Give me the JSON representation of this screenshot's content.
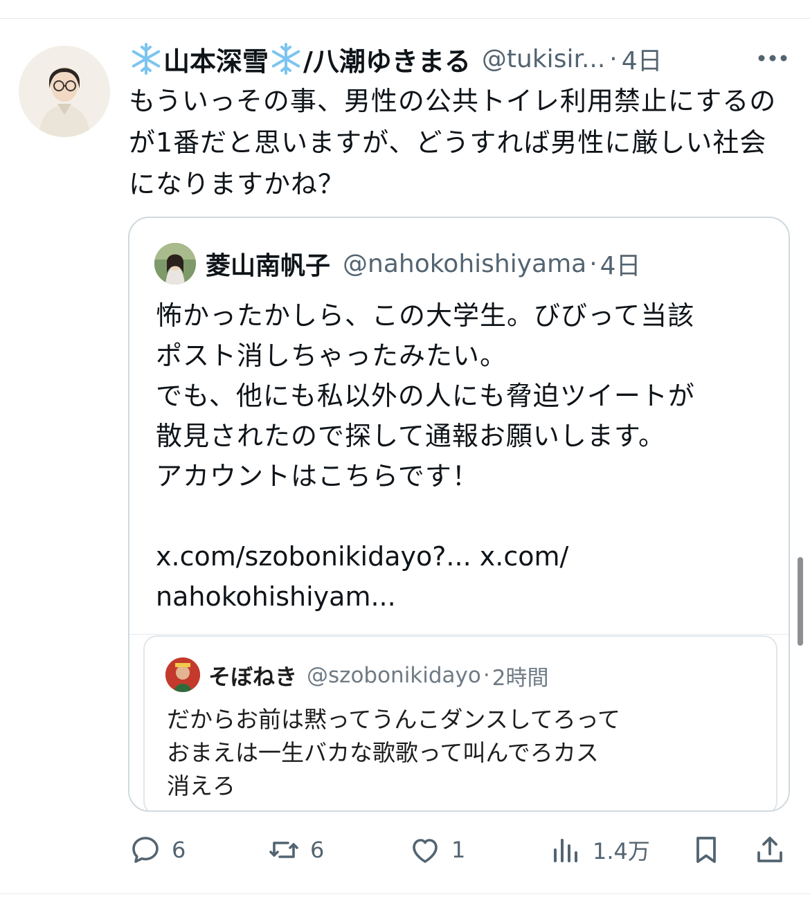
{
  "tweet": {
    "author": {
      "name_before": "山本深雪",
      "name_after": "/八潮ゆきまる",
      "handle": "@tukisir...",
      "dot": "·",
      "time": "4日"
    },
    "text": "もういっその事、男性の公共トイレ利用禁止にするのが1番だと思いますが、どうすれば男性に厳しい社会になりますかね？"
  },
  "quote": {
    "author": {
      "name": "菱山南帆子",
      "handle": "@nahokohishiyama",
      "dot": "·",
      "time": "4日"
    },
    "lines": [
      "怖かったかしら、この大学生。びびって当該",
      "ポスト消しちゃったみたい。",
      "でも、他にも私以外の人にも脅迫ツイートが",
      "散見されたので探して通報お願いします。",
      "アカウントはこちらです！"
    ],
    "links": {
      "link1": "x.com/szobonikidayo?...",
      "link2": "x.com/",
      "link2_cont": "nahokohishiyam..."
    },
    "embedded": {
      "author": {
        "name": "そぼねき",
        "handle": "@szobonikidayo",
        "dot": "·",
        "time": "2時間"
      },
      "lines": [
        "だからお前は黙ってうんこダンスしてろって",
        "おまえは一生バカな歌歌って叫んでろカス",
        "消えろ"
      ]
    }
  },
  "actions": {
    "reply_count": "6",
    "retweet_count": "6",
    "like_count": "1",
    "views_count": "1.4万"
  },
  "icons": {
    "more": "more-horizontal-icon",
    "reply": "reply-icon",
    "retweet": "retweet-icon",
    "like": "heart-icon",
    "views": "analytics-icon",
    "bookmark": "bookmark-icon",
    "share": "share-icon",
    "snowflake": "snowflake-emoji-icon"
  },
  "colors": {
    "text": "#0f1419",
    "secondary": "#536471",
    "border": "#cfd9de",
    "snowflake": "#7cc4f0"
  }
}
